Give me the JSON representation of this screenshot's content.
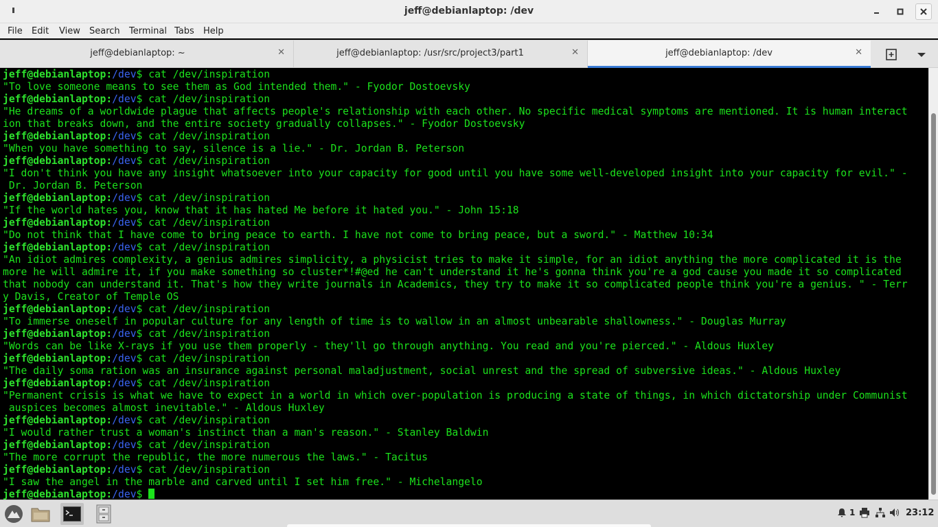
{
  "window": {
    "title": "jeff@debianlaptop: /dev"
  },
  "menu": [
    "File",
    "Edit",
    "View",
    "Search",
    "Terminal",
    "Tabs",
    "Help"
  ],
  "tabs": [
    {
      "label": "jeff@debianlaptop: ~",
      "active": false
    },
    {
      "label": "jeff@debianlaptop: /usr/src/project3/part1",
      "active": false
    },
    {
      "label": "jeff@debianlaptop: /dev",
      "active": true
    }
  ],
  "prompt": {
    "user": "jeff@debianlaptop",
    "sep": ":",
    "path": "/dev",
    "sym": "$"
  },
  "terminal_lines": [
    {
      "type": "prompt",
      "cmd": " cat /dev/inspiration"
    },
    {
      "type": "out",
      "text": "\"To love someone means to see them as God intended them.\" - Fyodor Dostoevsky"
    },
    {
      "type": "prompt",
      "cmd": " cat /dev/inspiration"
    },
    {
      "type": "out",
      "text": "\"He dreams of a worldwide plague that affects people's relationship with each other. No specific medical symptoms are mentioned. It is human interact"
    },
    {
      "type": "out",
      "text": "ion that breaks down, and the entire society gradually collapses.\" - Fyodor Dostoevsky"
    },
    {
      "type": "prompt",
      "cmd": " cat /dev/inspiration"
    },
    {
      "type": "out",
      "text": "\"When you have something to say, silence is a lie.\" - Dr. Jordan B. Peterson"
    },
    {
      "type": "prompt",
      "cmd": " cat /dev/inspiration"
    },
    {
      "type": "out",
      "text": "\"I don't think you have any insight whatsoever into your capacity for good until you have some well-developed insight into your capacity for evil.\" -"
    },
    {
      "type": "out",
      "text": " Dr. Jordan B. Peterson"
    },
    {
      "type": "prompt",
      "cmd": " cat /dev/inspiration"
    },
    {
      "type": "out",
      "text": "\"If the world hates you, know that it has hated Me before it hated you.\" - John 15:18"
    },
    {
      "type": "prompt",
      "cmd": " cat /dev/inspiration"
    },
    {
      "type": "out",
      "text": "\"Do not think that I have come to bring peace to earth. I have not come to bring peace, but a sword.\" - Matthew 10:34"
    },
    {
      "type": "prompt",
      "cmd": " cat /dev/inspiration"
    },
    {
      "type": "out",
      "text": "\"An idiot admires complexity, a genius admires simplicity, a physicist tries to make it simple, for an idiot anything the more complicated it is the"
    },
    {
      "type": "out",
      "text": "more he will admire it, if you make something so cluster*!#@ed he can't understand it he's gonna think you're a god cause you made it so complicated"
    },
    {
      "type": "out",
      "text": "that nobody can understand it. That's how they write journals in Academics, they try to make it so complicated people think you're a genius. \" - Terr"
    },
    {
      "type": "out",
      "text": "y Davis, Creator of Temple OS"
    },
    {
      "type": "prompt",
      "cmd": " cat /dev/inspiration"
    },
    {
      "type": "out",
      "text": "\"To immerse oneself in popular culture for any length of time is to wallow in an almost unbearable shallowness.\" - Douglas Murray"
    },
    {
      "type": "prompt",
      "cmd": " cat /dev/inspiration"
    },
    {
      "type": "out",
      "text": "\"Words can be like X-rays if you use them properly - they'll go through anything. You read and you're pierced.\" - Aldous Huxley"
    },
    {
      "type": "prompt",
      "cmd": " cat /dev/inspiration"
    },
    {
      "type": "out",
      "text": "\"The daily soma ration was an insurance against personal maladjustment, social unrest and the spread of subversive ideas.\" - Aldous Huxley"
    },
    {
      "type": "prompt",
      "cmd": " cat /dev/inspiration"
    },
    {
      "type": "out",
      "text": "\"Permanent crisis is what we have to expect in a world in which over-population is producing a state of things, in which dictatorship under Communist"
    },
    {
      "type": "out",
      "text": " auspices becomes almost inevitable.\" - Aldous Huxley"
    },
    {
      "type": "prompt",
      "cmd": " cat /dev/inspiration"
    },
    {
      "type": "out",
      "text": "\"I would rather trust a woman's instinct than a man's reason.\" - Stanley Baldwin"
    },
    {
      "type": "prompt",
      "cmd": " cat /dev/inspiration"
    },
    {
      "type": "out",
      "text": "\"The more corrupt the republic, the more numerous the laws.\" - Tacitus"
    },
    {
      "type": "prompt",
      "cmd": " cat /dev/inspiration"
    },
    {
      "type": "out",
      "text": "\"I saw the angel in the marble and carved until I set him free.\" - Michelangelo"
    },
    {
      "type": "prompt",
      "cmd": " ",
      "cursor": true
    }
  ],
  "taskbar": {
    "notification_count": "1",
    "clock": "23:12"
  },
  "colors": {
    "terminal_text": "#1ce21c",
    "prompt_path": "#3a64f2",
    "tab_accent": "#3a7bd5"
  }
}
